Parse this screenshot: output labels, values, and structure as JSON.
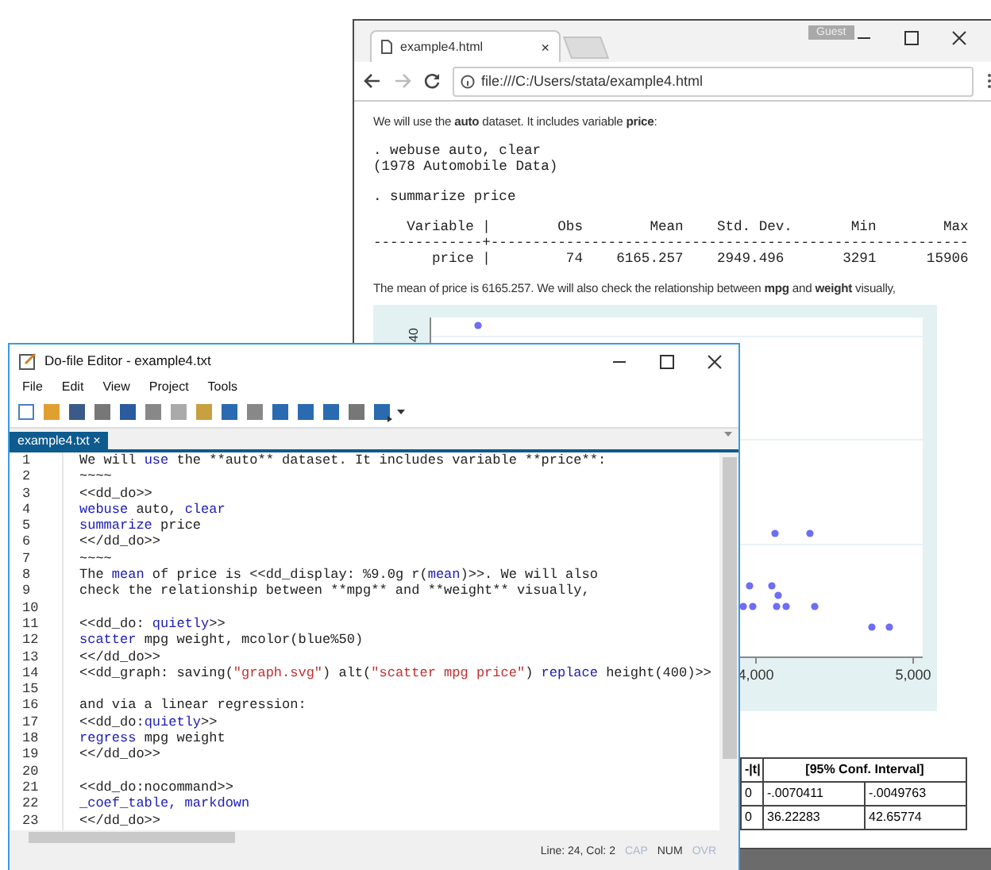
{
  "browser": {
    "tab_title": "example4.html",
    "guest_label": "Guest",
    "tab_close_label": "×",
    "address": "file:///C:/Users/stata/example4.html",
    "intro": "We will use the **auto** dataset. It includes variable **price**:",
    "output_blocks": [
      [
        ". webuse auto, clear",
        "(1978 Automobile Data)"
      ],
      [
        ". summarize price"
      ],
      [
        "    Variable |        Obs        Mean    Std. Dev.       Min        Max",
        "-------------+---------------------------------------------------------",
        "       price |         74    6165.257    2949.496       3291      15906"
      ]
    ],
    "mean_text": "The mean of price is 6165.257. We will also check the relationship between **mpg** and **weight** visually,",
    "chart": {
      "y_tick_labels": [
        "40"
      ],
      "x_tick_labels": [
        "4,000",
        "5,000"
      ]
    },
    "regression_table": {
      "header_cells": [
        "-|t|",
        "[95% Conf. Interval]"
      ],
      "rows": [
        [
          "0",
          "-.0070411",
          "-.0049763"
        ],
        [
          "0",
          "36.22283",
          "42.65774"
        ]
      ]
    }
  },
  "editor": {
    "title": "Do-file Editor - example4.txt",
    "menu": [
      "File",
      "Edit",
      "View",
      "Project",
      "Tools"
    ],
    "tabs": [
      {
        "label": "example4.txt",
        "close_label": "×",
        "selected": true
      }
    ],
    "lines": [
      {
        "number": "1",
        "segments": [
          {
            "kind": "plain",
            "text": "We will "
          },
          {
            "kind": "keyword",
            "text": "use"
          },
          {
            "kind": "plain",
            "text": " the **auto** dataset. It includes variable **price**:"
          }
        ]
      },
      {
        "number": "2",
        "segments": [
          {
            "kind": "plain",
            "text": "~~~~"
          }
        ]
      },
      {
        "number": "3",
        "segments": [
          {
            "kind": "plain",
            "text": "<<dd_do>>"
          }
        ]
      },
      {
        "number": "4",
        "segments": [
          {
            "kind": "keyword",
            "text": "webuse"
          },
          {
            "kind": "plain",
            "text": " auto, "
          },
          {
            "kind": "keyword",
            "text": "clear"
          }
        ]
      },
      {
        "number": "5",
        "segments": [
          {
            "kind": "keyword",
            "text": "summarize"
          },
          {
            "kind": "plain",
            "text": " price"
          }
        ]
      },
      {
        "number": "6",
        "segments": [
          {
            "kind": "plain",
            "text": "<</dd_do>>"
          }
        ]
      },
      {
        "number": "7",
        "segments": [
          {
            "kind": "plain",
            "text": "~~~~"
          }
        ]
      },
      {
        "number": "8",
        "segments": [
          {
            "kind": "plain",
            "text": "The "
          },
          {
            "kind": "keyword",
            "text": "mean"
          },
          {
            "kind": "plain",
            "text": " of price is <<dd_display: %9.0g r("
          },
          {
            "kind": "keyword",
            "text": "mean"
          },
          {
            "kind": "plain",
            "text": ")>>. We will also"
          }
        ]
      },
      {
        "number": "9",
        "segments": [
          {
            "kind": "plain",
            "text": "check the relationship between **mpg** and **weight** visually,"
          }
        ]
      },
      {
        "number": "10"
      },
      {
        "number": "11",
        "segments": [
          {
            "kind": "plain",
            "text": "<<dd_do: "
          },
          {
            "kind": "keyword",
            "text": "quietly"
          },
          {
            "kind": "plain",
            "text": ">>"
          }
        ]
      },
      {
        "number": "12",
        "segments": [
          {
            "kind": "keyword",
            "text": "scatter"
          },
          {
            "kind": "plain",
            "text": " mpg weight, mcolor(blue%50)"
          }
        ]
      },
      {
        "number": "13",
        "segments": [
          {
            "kind": "plain",
            "text": "<</dd_do>>"
          }
        ]
      },
      {
        "number": "14",
        "segments": [
          {
            "kind": "plain",
            "text": "<<dd_graph: saving("
          },
          {
            "kind": "string",
            "text": "\"graph.svg\""
          },
          {
            "kind": "plain",
            "text": ") alt("
          },
          {
            "kind": "string",
            "text": "\"scatter mpg price\""
          },
          {
            "kind": "plain",
            "text": ") "
          },
          {
            "kind": "keyword",
            "text": "replace"
          },
          {
            "kind": "plain",
            "text": " height(400)>>"
          }
        ]
      },
      {
        "number": "15"
      },
      {
        "number": "16",
        "segments": [
          {
            "kind": "plain",
            "text": "and via a linear regression:"
          }
        ]
      },
      {
        "number": "17",
        "segments": [
          {
            "kind": "plain",
            "text": "<<dd_do:"
          },
          {
            "kind": "keyword",
            "text": "quietly"
          },
          {
            "kind": "plain",
            "text": ">>"
          }
        ]
      },
      {
        "number": "18",
        "segments": [
          {
            "kind": "keyword",
            "text": "regress"
          },
          {
            "kind": "plain",
            "text": " mpg weight"
          }
        ]
      },
      {
        "number": "19",
        "segments": [
          {
            "kind": "plain",
            "text": "<</dd_do>>"
          }
        ]
      },
      {
        "number": "20"
      },
      {
        "number": "21",
        "segments": [
          {
            "kind": "plain",
            "text": "<<dd_do:nocommand>>"
          }
        ]
      },
      {
        "number": "22",
        "segments": [
          {
            "kind": "keyword",
            "text": "_coef_table, markdown"
          }
        ]
      },
      {
        "number": "23",
        "segments": [
          {
            "kind": "plain",
            "text": "<</dd_do>>"
          }
        ]
      }
    ],
    "status": {
      "position": "Line: 24, Col: 2",
      "indicators": [
        {
          "label": "CAP",
          "on": false
        },
        {
          "label": "NUM",
          "on": true
        },
        {
          "label": "OVR",
          "on": false
        }
      ]
    }
  }
}
